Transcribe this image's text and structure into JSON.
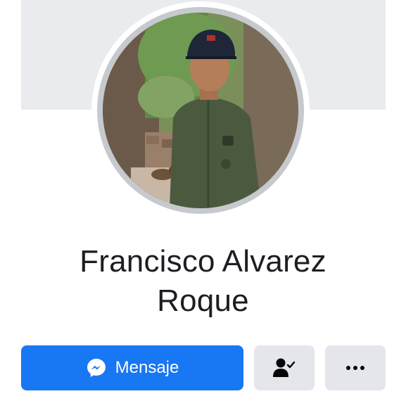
{
  "profile": {
    "name_line1": "Francisco Alvarez",
    "name_line2": "Roque",
    "avatar_alt": "Profile photo"
  },
  "actions": {
    "message_label": "Mensaje",
    "message_icon": "messenger-icon",
    "friend_icon": "friend-check-icon",
    "more_icon": "more-dots-icon"
  },
  "colors": {
    "primary": "#1877f2",
    "secondary_button": "#e4e6eb",
    "cover": "#e9ebee",
    "text": "#1c1e21"
  }
}
